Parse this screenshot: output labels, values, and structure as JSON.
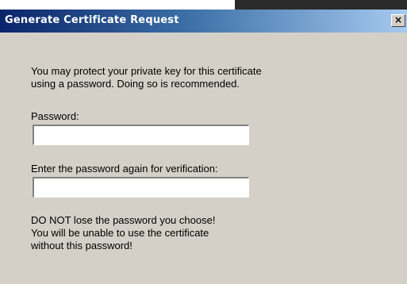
{
  "dialog": {
    "title": "Generate Certificate Request",
    "close_symbol": "×",
    "intro_line1": "You may protect your private key for this certificate",
    "intro_line2": "using a password. Doing so is recommended.",
    "password_label": "Password:",
    "password_value": "",
    "confirm_label": "Enter the password again for verification:",
    "confirm_value": "",
    "warning_line1": "DO NOT lose the password you choose!",
    "warning_line2": "You will be unable to use the certificate",
    "warning_line3": "without this password!"
  },
  "colors": {
    "titlebar_start": "#0a246a",
    "titlebar_end": "#a6caf0",
    "dialog_background": "#d4d0c8"
  },
  "icons": {
    "close": "close-icon"
  }
}
